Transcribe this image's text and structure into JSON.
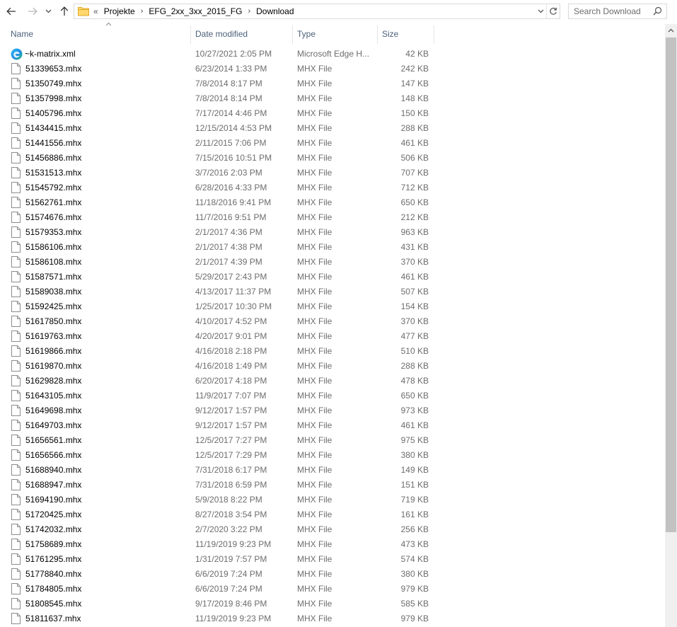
{
  "nav": {
    "back": "back-arrow-icon",
    "forward": "forward-arrow-icon",
    "recent": "chevron-down-icon",
    "up": "up-arrow-icon"
  },
  "address": {
    "overflow": "«",
    "crumbs": [
      "Projekte",
      "EFG_2xx_3xx_2015_FG",
      "Download"
    ]
  },
  "search": {
    "placeholder": "Search Download"
  },
  "columns": {
    "name": "Name",
    "date": "Date modified",
    "type": "Type",
    "size": "Size"
  },
  "files": [
    {
      "name": "~k-matrix.xml",
      "date": "10/27/2021 2:05 PM",
      "type": "Microsoft Edge H...",
      "size": "42 KB",
      "icon": "edge-icon"
    },
    {
      "name": "51339653.mhx",
      "date": "6/23/2014 1:33 PM",
      "type": "MHX File",
      "size": "242 KB",
      "icon": "file-icon"
    },
    {
      "name": "51350749.mhx",
      "date": "7/8/2014 8:17 PM",
      "type": "MHX File",
      "size": "147 KB",
      "icon": "file-icon"
    },
    {
      "name": "51357998.mhx",
      "date": "7/8/2014 8:14 PM",
      "type": "MHX File",
      "size": "148 KB",
      "icon": "file-icon"
    },
    {
      "name": "51405796.mhx",
      "date": "7/17/2014 4:46 PM",
      "type": "MHX File",
      "size": "150 KB",
      "icon": "file-icon"
    },
    {
      "name": "51434415.mhx",
      "date": "12/15/2014 4:53 PM",
      "type": "MHX File",
      "size": "288 KB",
      "icon": "file-icon"
    },
    {
      "name": "51441556.mhx",
      "date": "2/11/2015 7:06 PM",
      "type": "MHX File",
      "size": "461 KB",
      "icon": "file-icon"
    },
    {
      "name": "51456886.mhx",
      "date": "7/15/2016 10:51 PM",
      "type": "MHX File",
      "size": "506 KB",
      "icon": "file-icon"
    },
    {
      "name": "51531513.mhx",
      "date": "3/7/2016 2:03 PM",
      "type": "MHX File",
      "size": "707 KB",
      "icon": "file-icon"
    },
    {
      "name": "51545792.mhx",
      "date": "6/28/2016 4:33 PM",
      "type": "MHX File",
      "size": "712 KB",
      "icon": "file-icon"
    },
    {
      "name": "51562761.mhx",
      "date": "11/18/2016 9:41 PM",
      "type": "MHX File",
      "size": "650 KB",
      "icon": "file-icon"
    },
    {
      "name": "51574676.mhx",
      "date": "11/7/2016 9:51 PM",
      "type": "MHX File",
      "size": "212 KB",
      "icon": "file-icon"
    },
    {
      "name": "51579353.mhx",
      "date": "2/1/2017 4:36 PM",
      "type": "MHX File",
      "size": "963 KB",
      "icon": "file-icon"
    },
    {
      "name": "51586106.mhx",
      "date": "2/1/2017 4:38 PM",
      "type": "MHX File",
      "size": "431 KB",
      "icon": "file-icon"
    },
    {
      "name": "51586108.mhx",
      "date": "2/1/2017 4:39 PM",
      "type": "MHX File",
      "size": "370 KB",
      "icon": "file-icon"
    },
    {
      "name": "51587571.mhx",
      "date": "5/29/2017 2:43 PM",
      "type": "MHX File",
      "size": "461 KB",
      "icon": "file-icon"
    },
    {
      "name": "51589038.mhx",
      "date": "4/13/2017 11:37 PM",
      "type": "MHX File",
      "size": "507 KB",
      "icon": "file-icon"
    },
    {
      "name": "51592425.mhx",
      "date": "1/25/2017 10:30 PM",
      "type": "MHX File",
      "size": "154 KB",
      "icon": "file-icon"
    },
    {
      "name": "51617850.mhx",
      "date": "4/10/2017 4:52 PM",
      "type": "MHX File",
      "size": "370 KB",
      "icon": "file-icon"
    },
    {
      "name": "51619763.mhx",
      "date": "4/20/2017 9:01 PM",
      "type": "MHX File",
      "size": "477 KB",
      "icon": "file-icon"
    },
    {
      "name": "51619866.mhx",
      "date": "4/16/2018 2:18 PM",
      "type": "MHX File",
      "size": "510 KB",
      "icon": "file-icon"
    },
    {
      "name": "51619870.mhx",
      "date": "4/16/2018 1:49 PM",
      "type": "MHX File",
      "size": "288 KB",
      "icon": "file-icon"
    },
    {
      "name": "51629828.mhx",
      "date": "6/20/2017 4:18 PM",
      "type": "MHX File",
      "size": "478 KB",
      "icon": "file-icon"
    },
    {
      "name": "51643105.mhx",
      "date": "11/9/2017 7:07 PM",
      "type": "MHX File",
      "size": "650 KB",
      "icon": "file-icon"
    },
    {
      "name": "51649698.mhx",
      "date": "9/12/2017 1:57 PM",
      "type": "MHX File",
      "size": "973 KB",
      "icon": "file-icon"
    },
    {
      "name": "51649703.mhx",
      "date": "9/12/2017 1:57 PM",
      "type": "MHX File",
      "size": "461 KB",
      "icon": "file-icon"
    },
    {
      "name": "51656561.mhx",
      "date": "12/5/2017 7:27 PM",
      "type": "MHX File",
      "size": "975 KB",
      "icon": "file-icon"
    },
    {
      "name": "51656566.mhx",
      "date": "12/5/2017 7:29 PM",
      "type": "MHX File",
      "size": "380 KB",
      "icon": "file-icon"
    },
    {
      "name": "51688940.mhx",
      "date": "7/31/2018 6:17 PM",
      "type": "MHX File",
      "size": "149 KB",
      "icon": "file-icon"
    },
    {
      "name": "51688947.mhx",
      "date": "7/31/2018 6:59 PM",
      "type": "MHX File",
      "size": "151 KB",
      "icon": "file-icon"
    },
    {
      "name": "51694190.mhx",
      "date": "5/9/2018 8:22 PM",
      "type": "MHX File",
      "size": "719 KB",
      "icon": "file-icon"
    },
    {
      "name": "51720425.mhx",
      "date": "8/27/2018 3:54 PM",
      "type": "MHX File",
      "size": "161 KB",
      "icon": "file-icon"
    },
    {
      "name": "51742032.mhx",
      "date": "2/7/2020 3:22 PM",
      "type": "MHX File",
      "size": "256 KB",
      "icon": "file-icon"
    },
    {
      "name": "51758689.mhx",
      "date": "11/19/2019 9:23 PM",
      "type": "MHX File",
      "size": "473 KB",
      "icon": "file-icon"
    },
    {
      "name": "51761295.mhx",
      "date": "1/31/2019 7:57 PM",
      "type": "MHX File",
      "size": "574 KB",
      "icon": "file-icon"
    },
    {
      "name": "51778840.mhx",
      "date": "6/6/2019 7:24 PM",
      "type": "MHX File",
      "size": "380 KB",
      "icon": "file-icon"
    },
    {
      "name": "51784805.mhx",
      "date": "6/6/2019 7:24 PM",
      "type": "MHX File",
      "size": "979 KB",
      "icon": "file-icon"
    },
    {
      "name": "51808545.mhx",
      "date": "9/17/2019 8:46 PM",
      "type": "MHX File",
      "size": "585 KB",
      "icon": "file-icon"
    },
    {
      "name": "51811637.mhx",
      "date": "11/19/2019 9:23 PM",
      "type": "MHX File",
      "size": "979 KB",
      "icon": "file-icon"
    }
  ],
  "scrollbar": {
    "position": 0.0
  }
}
